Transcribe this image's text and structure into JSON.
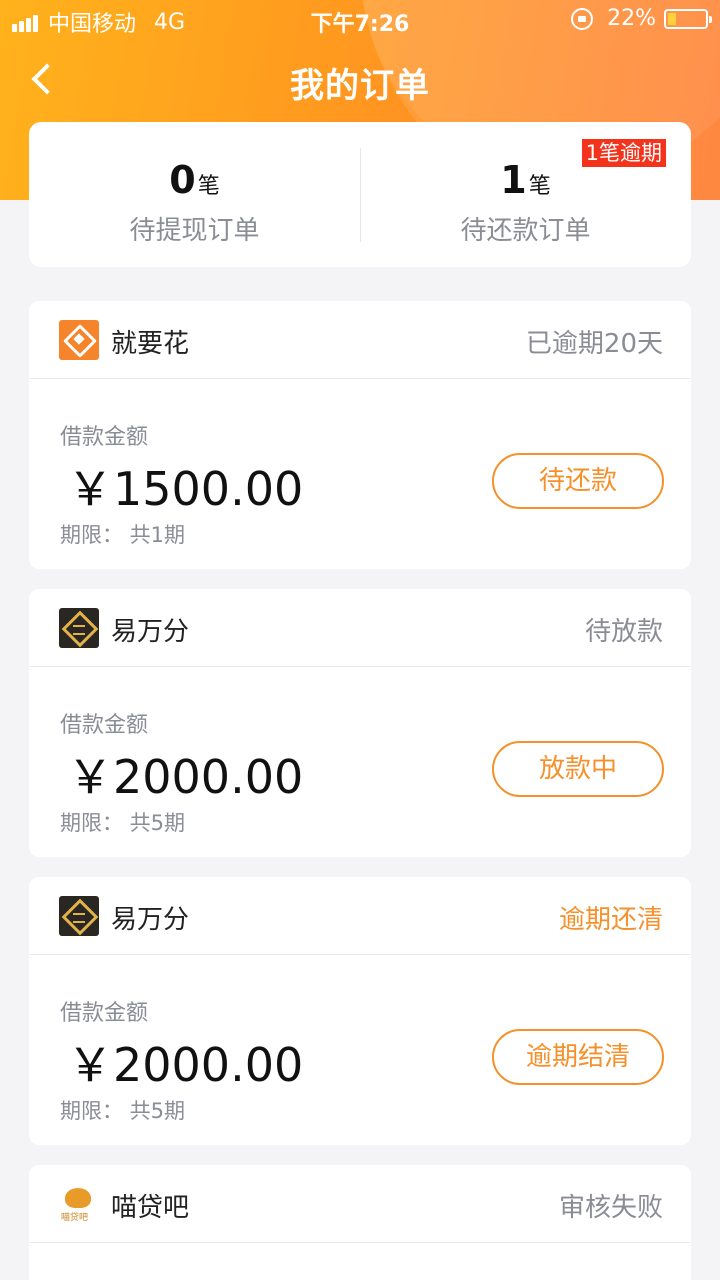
{
  "status_bar": {
    "carrier": "中国移动",
    "network": "4G",
    "time": "下午7:26",
    "battery": "22%",
    "battery_level": 0.22
  },
  "nav": {
    "title": "我的订单",
    "back_icon": "chevron-left-icon"
  },
  "summary": {
    "left": {
      "count": "0",
      "unit": "笔",
      "label": "待提现订单"
    },
    "right": {
      "count": "1",
      "unit": "笔",
      "label": "待还款订单",
      "badge": "1笔逾期"
    }
  },
  "orders": [
    {
      "brand": "就要花",
      "logo": "jiuyaohua-logo-icon",
      "status": "已逾期20天",
      "status_color": "#8a8c96",
      "amount_label": "借款金额",
      "amount": "￥1500.00",
      "term": "期限：  共1期",
      "action": "待还款"
    },
    {
      "brand": "易万分",
      "logo": "yiwanfen-logo-icon",
      "status": "待放款",
      "status_color": "#8a8c96",
      "amount_label": "借款金额",
      "amount": "￥2000.00",
      "term": "期限：  共5期",
      "action": "放款中"
    },
    {
      "brand": "易万分",
      "logo": "yiwanfen-logo-icon",
      "status": "逾期还清",
      "status_color": "#f5902a",
      "amount_label": "借款金额",
      "amount": "￥2000.00",
      "term": "期限：  共5期",
      "action": "逾期结清"
    },
    {
      "brand": "喵贷吧",
      "logo": "miaodaiba-logo-icon",
      "logo_text": "喵贷吧",
      "status": "审核失败",
      "status_color": "#8a8c96"
    }
  ],
  "colors": {
    "accent": "#f5902a",
    "header_start": "#ffb21c",
    "header_end": "#ff7a2c",
    "badge": "#f4331c"
  }
}
